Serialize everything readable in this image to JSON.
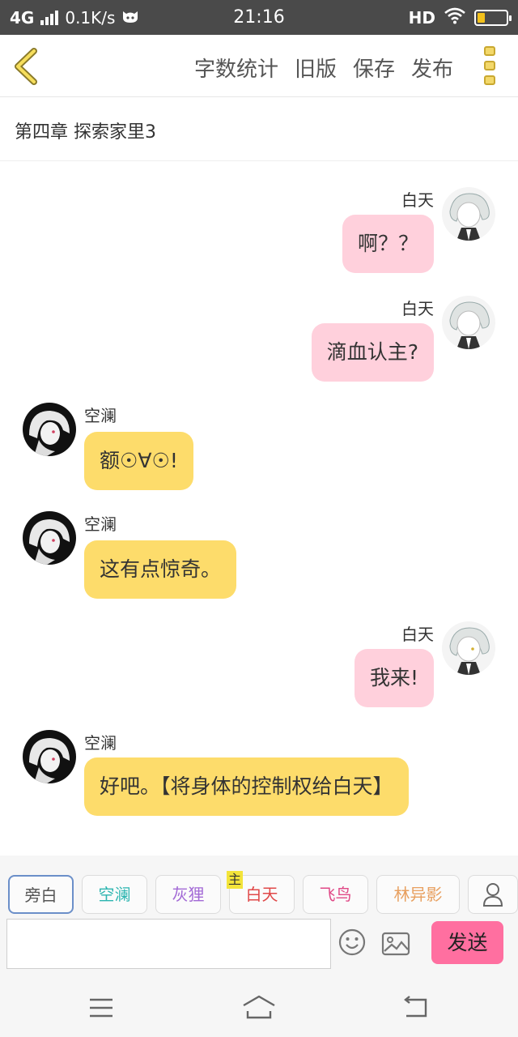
{
  "status_bar": {
    "network": "4G",
    "speed": "0.1K/s",
    "time": "21:16",
    "hd": "HD",
    "battery_level": 0.25
  },
  "toolbar": {
    "word_count": "字数统计",
    "old_version": "旧版",
    "save": "保存",
    "publish": "发布"
  },
  "chapter_title": "第四章 探索家里3",
  "messages": [
    {
      "side": "right",
      "name": "白天",
      "text": "啊？？"
    },
    {
      "side": "right",
      "name": "白天",
      "text": "滴血认主?"
    },
    {
      "side": "left",
      "name": "空澜",
      "text": "额☉∀☉!"
    },
    {
      "side": "left",
      "name": "空澜",
      "text": "这有点惊奇。"
    },
    {
      "side": "right",
      "name": "白天",
      "text": "我来!"
    },
    {
      "side": "left",
      "name": "空澜",
      "text": "好吧。【将身体的控制权给白天】"
    }
  ],
  "roles": [
    {
      "label": "旁白",
      "color": "#555555"
    },
    {
      "label": "空澜",
      "color": "#2cb5b0"
    },
    {
      "label": "灰狸",
      "color": "#a36ad6"
    },
    {
      "label": "白天",
      "color": "#e04848",
      "badge": "主"
    },
    {
      "label": "飞鸟",
      "color": "#e04886"
    },
    {
      "label": "林异影",
      "color": "#e8a060"
    }
  ],
  "composer": {
    "input_value": "",
    "send_label": "发送"
  },
  "colors": {
    "accent_yellow": "#fddc6b",
    "accent_pink": "#ffd0dc",
    "send_button": "#ff6fa0"
  }
}
